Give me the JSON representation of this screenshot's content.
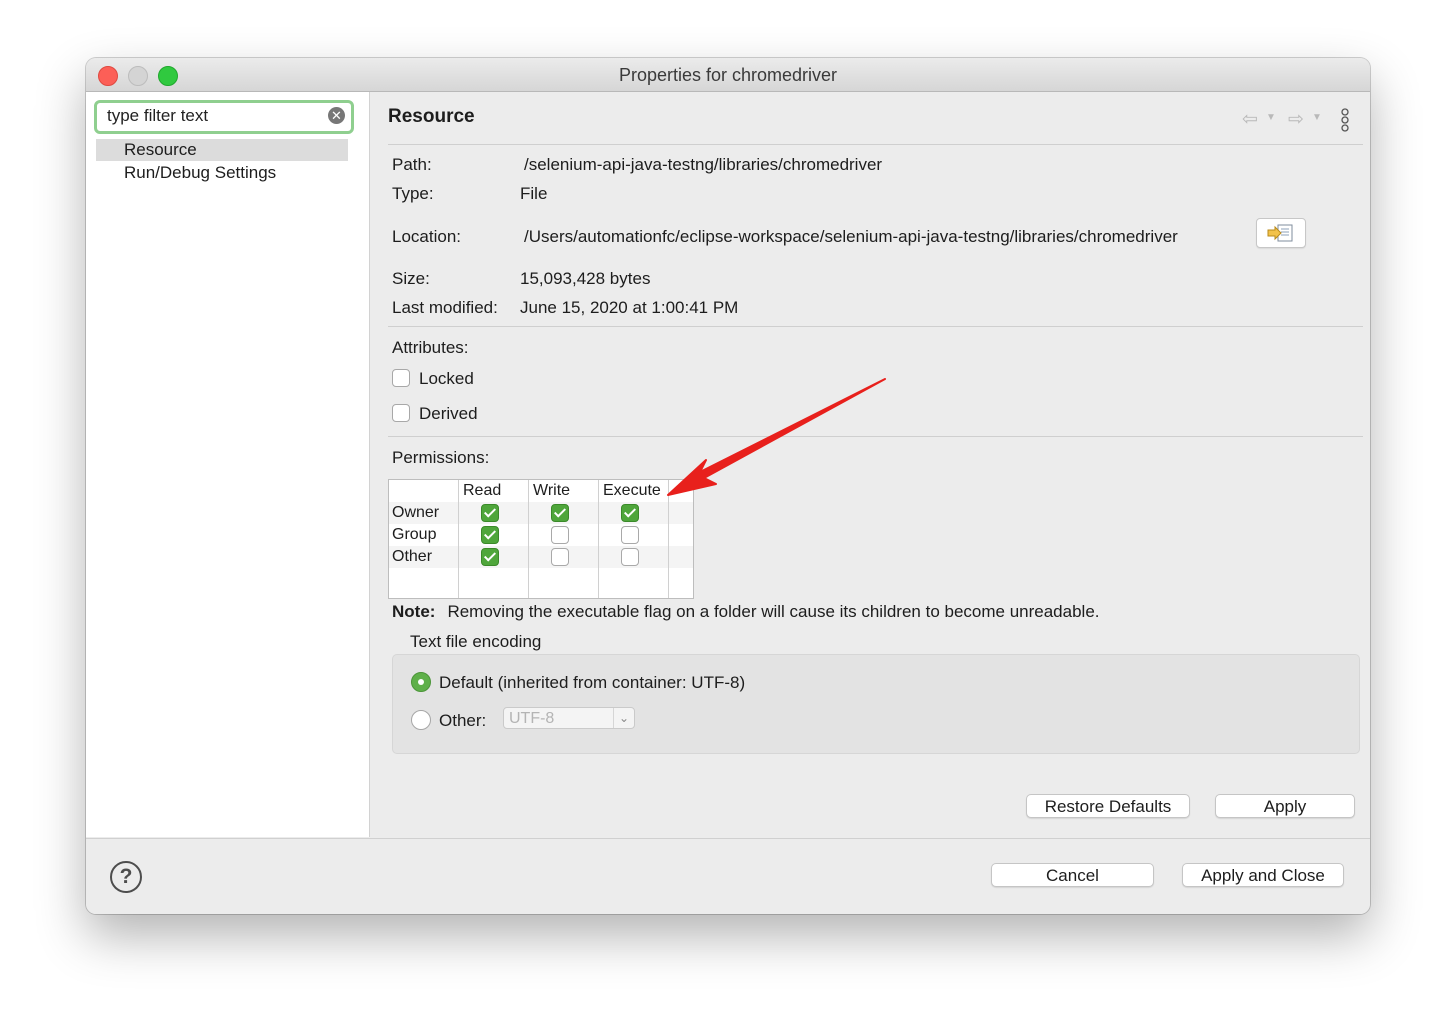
{
  "window": {
    "title": "Properties for chromedriver"
  },
  "sidebar": {
    "filter_value": "type filter text",
    "items": [
      {
        "label": "Resource",
        "selected": true
      },
      {
        "label": "Run/Debug Settings",
        "selected": false
      }
    ]
  },
  "main": {
    "title": "Resource",
    "nav": {
      "back_icon": "back-arrow-icon",
      "forward_icon": "forward-arrow-icon",
      "menu_icon": "vertical-dots-icon"
    },
    "info": {
      "path_label": "Path:",
      "path_value": "/selenium-api-java-testng/libraries/chromedriver",
      "type_label": "Type:",
      "type_value": "File",
      "location_label": "Location:",
      "location_value": "/Users/automationfc/eclipse-workspace/selenium-api-java-testng/libraries/chromedriver",
      "size_label": "Size:",
      "size_value": "15,093,428  bytes",
      "modified_label": "Last modified:",
      "modified_value": "June 15, 2020 at 1:00:41 PM"
    },
    "attributes": {
      "label": "Attributes:",
      "locked": {
        "label": "Locked",
        "checked": false
      },
      "derived": {
        "label": "Derived",
        "checked": false
      }
    },
    "permissions": {
      "label": "Permissions:",
      "columns": [
        "Read",
        "Write",
        "Execute"
      ],
      "rows": [
        {
          "label": "Owner",
          "values": [
            true,
            true,
            true
          ]
        },
        {
          "label": "Group",
          "values": [
            true,
            false,
            false
          ]
        },
        {
          "label": "Other",
          "values": [
            true,
            false,
            false
          ]
        }
      ]
    },
    "note": {
      "label": "Note:",
      "text": "Removing the executable flag on a folder will cause its children to become unreadable."
    },
    "encoding": {
      "title": "Text file encoding",
      "default_label": "Default (inherited from container: UTF-8)",
      "other_label": "Other:",
      "other_value": "UTF-8",
      "selected": "default"
    },
    "buttons": {
      "restore_defaults": "Restore Defaults",
      "apply": "Apply"
    }
  },
  "footer": {
    "help_icon": "help-icon",
    "cancel": "Cancel",
    "apply_close": "Apply and Close"
  },
  "colors": {
    "accent_green": "#4fa63b",
    "filter_focus": "#8fcf8f",
    "annotation_arrow": "#e8201c"
  }
}
